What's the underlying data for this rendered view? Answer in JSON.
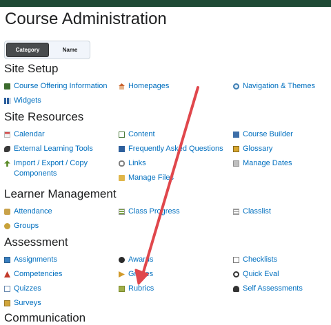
{
  "page": {
    "title": "Course Administration"
  },
  "view_toggle": {
    "category_label": "Category",
    "name_label": "Name",
    "selected": "Category"
  },
  "sections": {
    "site_setup": {
      "title": "Site Setup",
      "items": [
        {
          "label": "Course Offering Information",
          "icon": "book-icon"
        },
        {
          "label": "Homepages",
          "icon": "house-icon"
        },
        {
          "label": "Navigation & Themes",
          "icon": "compass-icon"
        },
        {
          "label": "Widgets",
          "icon": "widgets-icon"
        }
      ]
    },
    "site_resources": {
      "title": "Site Resources",
      "items": [
        {
          "label": "Calendar",
          "icon": "calendar-icon"
        },
        {
          "label": "Content",
          "icon": "open-book-icon"
        },
        {
          "label": "Course Builder",
          "icon": "builder-icon"
        },
        {
          "label": "External Learning Tools",
          "icon": "puzzle-icon"
        },
        {
          "label": "Frequently Asked Questions",
          "icon": "faq-icon"
        },
        {
          "label": "Glossary",
          "icon": "glossary-icon"
        },
        {
          "label": "Import / Export / Copy Components",
          "icon": "import-export-icon"
        },
        {
          "label": "Links",
          "icon": "link-icon"
        },
        {
          "label": "Manage Dates",
          "icon": "dates-icon"
        },
        {
          "label": "Manage Files",
          "icon": "folder-icon"
        }
      ]
    },
    "learner_management": {
      "title": "Learner Management",
      "items": [
        {
          "label": "Attendance",
          "icon": "attendance-icon"
        },
        {
          "label": "Class Progress",
          "icon": "progress-icon"
        },
        {
          "label": "Classlist",
          "icon": "classlist-icon"
        },
        {
          "label": "Groups",
          "icon": "groups-icon"
        }
      ]
    },
    "assessment": {
      "title": "Assessment",
      "items": [
        {
          "label": "Assignments",
          "icon": "assignments-icon"
        },
        {
          "label": "Awards",
          "icon": "award-icon"
        },
        {
          "label": "Checklists",
          "icon": "checklist-icon"
        },
        {
          "label": "Competencies",
          "icon": "competencies-icon"
        },
        {
          "label": "Grades",
          "icon": "grades-icon"
        },
        {
          "label": "Quick Eval",
          "icon": "quick-eval-icon"
        },
        {
          "label": "Quizzes",
          "icon": "quiz-icon"
        },
        {
          "label": "Rubrics",
          "icon": "rubric-icon"
        },
        {
          "label": "Self Assessments",
          "icon": "self-assessment-icon"
        },
        {
          "label": "Surveys",
          "icon": "survey-icon"
        }
      ]
    },
    "communication": {
      "title": "Communication"
    }
  },
  "colors": {
    "link": "#006fbf",
    "header_bar": "#1f4a35",
    "annotation_arrow": "#e0474c"
  }
}
